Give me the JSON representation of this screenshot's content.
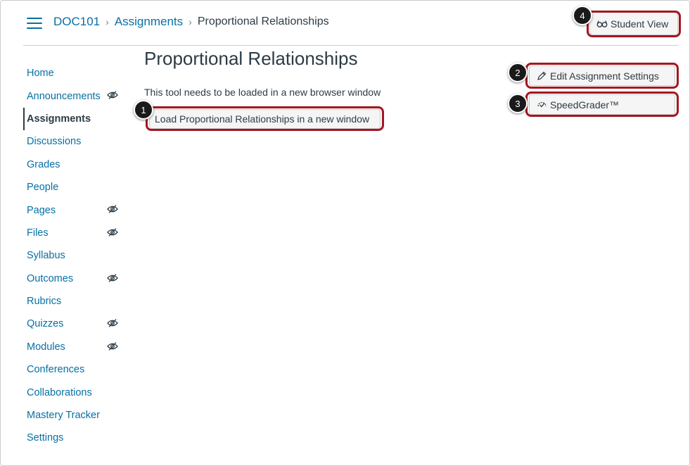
{
  "header": {
    "breadcrumb": [
      {
        "label": "DOC101"
      },
      {
        "label": "Assignments"
      },
      {
        "label": "Proportional Relationships"
      }
    ],
    "student_view_label": "Student View"
  },
  "sidebar": {
    "items": [
      {
        "label": "Home",
        "hidden": false
      },
      {
        "label": "Announcements",
        "hidden": true
      },
      {
        "label": "Assignments",
        "hidden": false,
        "active": true
      },
      {
        "label": "Discussions",
        "hidden": false
      },
      {
        "label": "Grades",
        "hidden": false
      },
      {
        "label": "People",
        "hidden": false
      },
      {
        "label": "Pages",
        "hidden": true
      },
      {
        "label": "Files",
        "hidden": true
      },
      {
        "label": "Syllabus",
        "hidden": false
      },
      {
        "label": "Outcomes",
        "hidden": true
      },
      {
        "label": "Rubrics",
        "hidden": false
      },
      {
        "label": "Quizzes",
        "hidden": true
      },
      {
        "label": "Modules",
        "hidden": true
      },
      {
        "label": "Conferences",
        "hidden": false
      },
      {
        "label": "Collaborations",
        "hidden": false
      },
      {
        "label": "Mastery Tracker",
        "hidden": false
      },
      {
        "label": "Settings",
        "hidden": false
      }
    ]
  },
  "main": {
    "title": "Proportional Relationships",
    "description": "This tool needs to be loaded in a new browser window",
    "load_button_label": "Load Proportional Relationships in a new window"
  },
  "actions": {
    "edit_settings_label": "Edit Assignment Settings",
    "speedgrader_label": "SpeedGrader™"
  },
  "callouts": {
    "one": "1",
    "two": "2",
    "three": "3",
    "four": "4"
  },
  "colors": {
    "link": "#0770a3",
    "text": "#2d3b45",
    "highlight": "#a3171f",
    "badge": "#1a1a1a"
  }
}
